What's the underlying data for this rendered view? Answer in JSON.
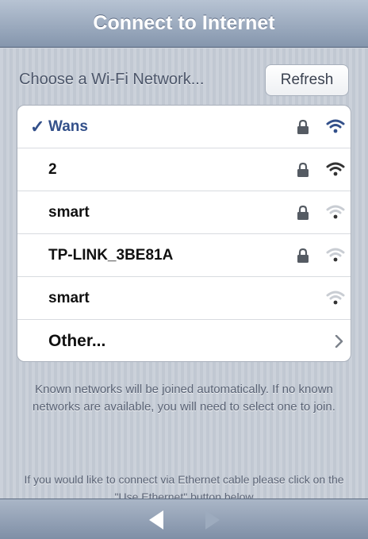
{
  "header": {
    "title": "Connect to Internet"
  },
  "network_section": {
    "label": "Choose a Wi-Fi Network...",
    "refresh_label": "Refresh"
  },
  "networks": [
    {
      "name": "Wans",
      "selected": true,
      "locked": true,
      "signal_bars": 3
    },
    {
      "name": "2",
      "selected": false,
      "locked": true,
      "signal_bars": 3
    },
    {
      "name": "smart",
      "selected": false,
      "locked": true,
      "signal_bars": 1
    },
    {
      "name": "TP-LINK_3BE81A",
      "selected": false,
      "locked": true,
      "signal_bars": 1
    },
    {
      "name": "smart",
      "selected": false,
      "locked": false,
      "signal_bars": 1
    }
  ],
  "other": {
    "label": "Other..."
  },
  "selected_mark": "✓",
  "info": {
    "known_networks": "Known networks will be joined automatically. If no known networks are available, you will need to select one to join.",
    "ethernet": "If you would like to connect via Ethernet cable please click on the \"Use Ethernet\" button below"
  },
  "colors": {
    "accent": "#33508a",
    "titlebar": "#8596ad",
    "background": "#c5ccd6"
  },
  "icons": {
    "lock": "lock-icon",
    "wifi": "wifi-icon",
    "chevron": "chevron-right-icon",
    "back": "back-arrow-icon",
    "forward": "forward-arrow-icon"
  }
}
